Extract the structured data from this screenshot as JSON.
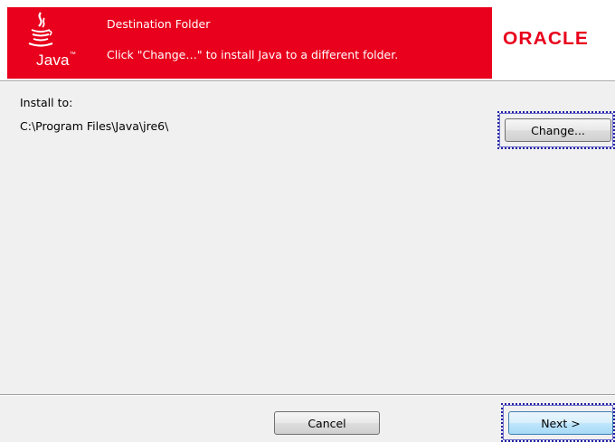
{
  "header": {
    "title": "Destination Folder",
    "subtitle": "Click \"Change…\" to install Java to a different folder.",
    "java_logo_text": "Java",
    "oracle_logo_text": "ORACLE",
    "brand_red": "#e8001c"
  },
  "main": {
    "install_label": "Install to:",
    "install_path": "C:\\Program Files\\Java\\jre6\\",
    "change_button": "Change..."
  },
  "footer": {
    "cancel_button": "Cancel",
    "next_button": "Next >"
  }
}
